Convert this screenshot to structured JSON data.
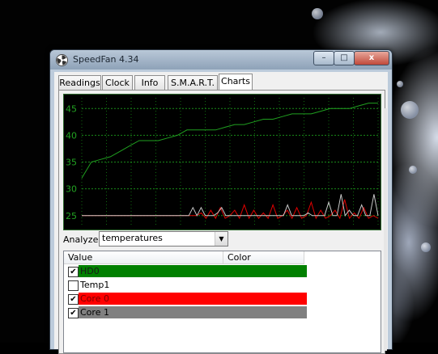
{
  "window": {
    "title": "SpeedFan 4.34",
    "close_glyph": "x",
    "min_glyph": "–",
    "max_glyph": "□"
  },
  "tabs": [
    {
      "label": "Readings",
      "active": false
    },
    {
      "label": "Clock",
      "active": false
    },
    {
      "label": "Info",
      "active": false
    },
    {
      "label": "S.M.A.R.T.",
      "active": false
    },
    {
      "label": "Charts",
      "active": true
    }
  ],
  "analyze": {
    "label": "Analyze",
    "value": "temperatures"
  },
  "list": {
    "columns": [
      "Value",
      "Color"
    ],
    "rows": [
      {
        "label": "HD0",
        "checked": true,
        "color": "#008000",
        "text_color": "#1a1a1a"
      },
      {
        "label": "Temp1",
        "checked": false,
        "color": "#ffffff",
        "text_color": "#000000"
      },
      {
        "label": "Core 0",
        "checked": true,
        "color": "#ff0000",
        "text_color": "#7a0000"
      },
      {
        "label": "Core 1",
        "checked": true,
        "color": "#808080",
        "text_color": "#000000"
      }
    ]
  },
  "chart_data": {
    "type": "line",
    "y_ticks": [
      "45",
      "40",
      "35",
      "30",
      "25"
    ],
    "ylim": [
      23,
      47
    ],
    "series": [
      {
        "name": "HD0",
        "color": "#20a020",
        "values": [
          32,
          35,
          35.5,
          36,
          37,
          38,
          39,
          39,
          39,
          39.5,
          40,
          41,
          41,
          41,
          41,
          41.5,
          42,
          42,
          42.5,
          43,
          43,
          43.5,
          44,
          44,
          44,
          44.5,
          45,
          45,
          45,
          45.5,
          46,
          46
        ]
      },
      {
        "name": "Core 0",
        "color": "#e00000",
        "values": [
          25,
          25,
          25,
          25,
          25,
          25,
          25,
          25,
          25,
          25,
          25,
          25,
          25,
          25,
          25,
          25,
          25,
          25,
          25,
          25,
          25,
          25,
          25,
          25,
          25,
          25.5,
          24.5,
          26,
          24.5,
          26.5,
          24.5,
          25,
          26,
          24.5,
          27,
          24.5,
          26,
          24.5,
          25.5,
          24.5,
          27,
          24.5,
          25,
          26,
          24.5,
          26.5,
          24.5,
          25,
          27.5,
          24.5,
          26,
          24.5,
          25,
          26,
          24.5,
          28,
          24.5,
          25.5,
          24.5,
          26.5,
          24.5,
          25,
          24.5
        ]
      },
      {
        "name": "Core 1",
        "color": "#c8c8c8",
        "values": [
          25,
          25,
          25,
          25,
          25,
          25,
          25,
          25,
          25,
          25,
          25,
          25,
          25,
          25,
          25,
          25,
          25,
          25,
          25,
          25,
          25,
          25,
          25,
          25,
          25,
          25,
          25,
          26.5,
          25,
          26.5,
          25,
          25,
          25,
          25.5,
          26.5,
          25,
          25,
          25,
          25,
          25,
          25,
          25,
          25,
          25,
          25,
          25,
          25,
          25,
          25,
          25,
          27,
          25,
          25,
          25,
          25,
          25.5,
          25,
          25,
          25,
          25,
          27.5,
          25,
          25,
          29,
          25,
          26,
          25,
          25,
          27,
          25,
          25,
          29,
          25
        ]
      }
    ]
  }
}
